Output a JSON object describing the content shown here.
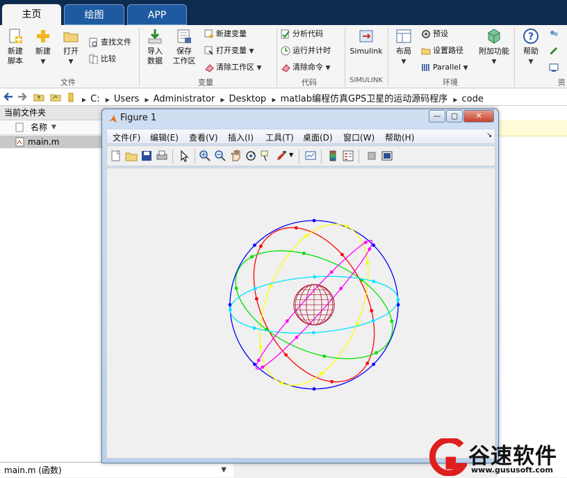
{
  "tabs": [
    {
      "label": "主页"
    },
    {
      "label": "绘图"
    },
    {
      "label": "APP"
    }
  ],
  "ribbon": {
    "file": {
      "new_script": "新建\n脚本",
      "new": "新建",
      "open": "打开",
      "find_files": "查找文件",
      "compare": "比较",
      "group": "文件"
    },
    "variable": {
      "import": "导入\n数据",
      "save_ws": "保存\n工作区",
      "new_var": "新建变量",
      "open_var": "打开变量",
      "clear_ws": "清除工作区",
      "group": "变量"
    },
    "code": {
      "analyze": "分析代码",
      "run_time": "运行并计时",
      "clear_cmds": "清除命令",
      "group": "代码"
    },
    "simulink": {
      "label": "Simulink",
      "group": "SIMULINK"
    },
    "env": {
      "layout": "布局",
      "prefs": "预设",
      "set_path": "设置路径",
      "parallel": "Parallel",
      "addons": "附加功能",
      "group": "环境"
    },
    "resources": {
      "help": "帮助",
      "group": "资"
    }
  },
  "address": {
    "crumbs": [
      "C:",
      "Users",
      "Administrator",
      "Desktop",
      "matlab编程仿真GPS卫星的运动源码程序",
      "code"
    ]
  },
  "current_folder": {
    "title": "当前文件夹",
    "col_name": "名称",
    "file": "main.m",
    "status": "main.m  (函数)"
  },
  "figure": {
    "title": "Figure 1",
    "menus": [
      "文件(F)",
      "编辑(E)",
      "查看(V)",
      "插入(I)",
      "工具(T)",
      "桌面(D)",
      "窗口(W)",
      "帮助(H)"
    ]
  },
  "watermark": {
    "brand": "谷速软件",
    "url": "www.gususoft.com"
  },
  "colors": {
    "tabbar": "#0d2a4f",
    "orbits": [
      "#0000ff",
      "#ff0000",
      "#ffff00",
      "#00e000",
      "#00e5ff",
      "#ff00ff"
    ],
    "earth": "#b0203c"
  }
}
